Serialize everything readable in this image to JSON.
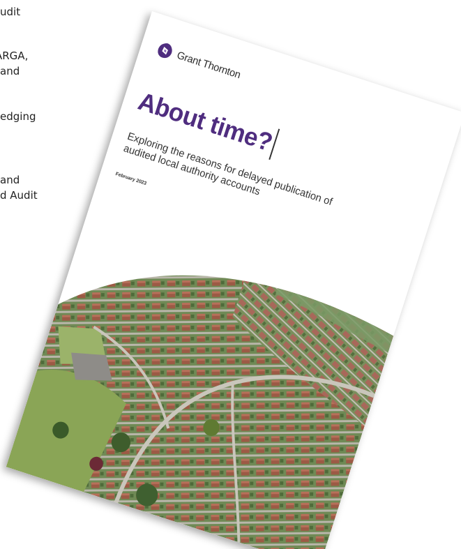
{
  "background_text": {
    "lines": [
      "udit",
      "ARGA,",
      "and",
      "edging",
      "and",
      "d Audit"
    ]
  },
  "report": {
    "logo": {
      "name": "Grant Thornton",
      "icon": "grant-thornton-logo-mark",
      "color": "#4f2d7f"
    },
    "title": "About time?",
    "subtitle": "Exploring the reasons for delayed publication of audited local authority accounts",
    "date": "February 2023",
    "cover_image": "aerial photo of suburban housing estate"
  }
}
